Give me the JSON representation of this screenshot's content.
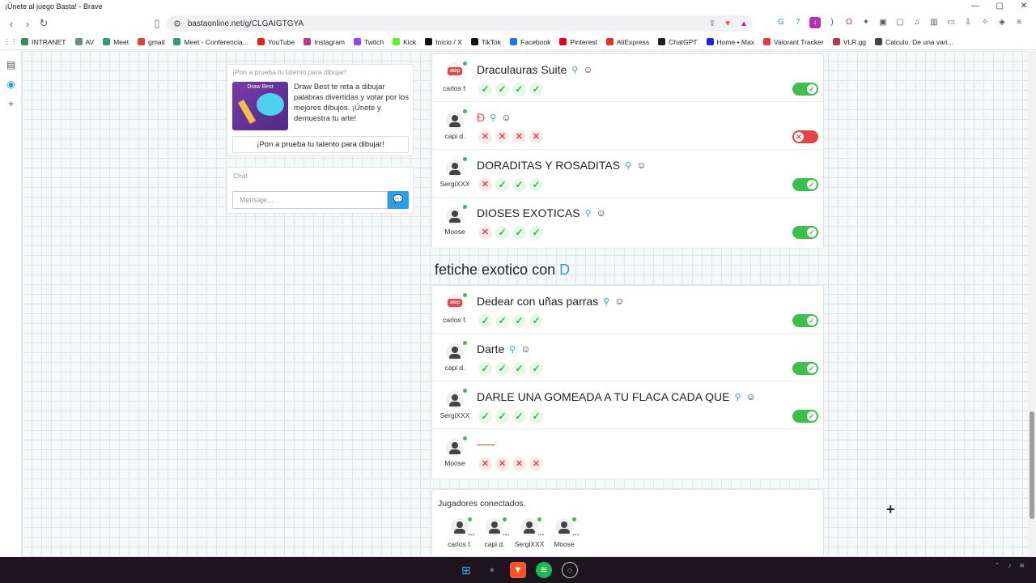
{
  "window": {
    "title": "¡Únete al juego Basta! - Brave",
    "controls": [
      "—",
      "▢",
      "✕"
    ]
  },
  "browser": {
    "url": "bastaonline.net/g/CLGAIGTGYA",
    "bookmarks": [
      {
        "label": "INTRANET",
        "color": "#3a8a5a"
      },
      {
        "label": "AV",
        "color": "#6a8a8a"
      },
      {
        "label": "Meet",
        "color": "#2f9e6a"
      },
      {
        "label": "gmail",
        "color": "#d44638"
      },
      {
        "label": "Meet - Conferencia...",
        "color": "#2f9e6a"
      },
      {
        "label": "YouTube",
        "color": "#e62117"
      },
      {
        "label": "Instagram",
        "color": "#c13584"
      },
      {
        "label": "Twitch",
        "color": "#9146ff"
      },
      {
        "label": "Kick",
        "color": "#53fc18"
      },
      {
        "label": "Inicio / X",
        "color": "#111111"
      },
      {
        "label": "TikTok",
        "color": "#111111"
      },
      {
        "label": "Facebook",
        "color": "#1877f2"
      },
      {
        "label": "Pinterest",
        "color": "#e60023"
      },
      {
        "label": "AliExpress",
        "color": "#e43225"
      },
      {
        "label": "ChatGPT",
        "color": "#222222"
      },
      {
        "label": "Home • Max",
        "color": "#1a2adb"
      },
      {
        "label": "Valorant Tracker",
        "color": "#e43a3a"
      },
      {
        "label": "VLR.gg",
        "color": "#b23a52"
      },
      {
        "label": "Calculo. De una vari...",
        "color": "#444444"
      }
    ]
  },
  "promo": {
    "header": "¡Pon a prueba tu talento para dibujar!",
    "image_title": "Draw Best",
    "text": "Draw Best te reta a dibujar palabras divertidas y votar por los mejores dibujos. ¡Únete y demuestra tu arte!",
    "button": "¡Pon a prueba tu talento para dibujar!"
  },
  "chat": {
    "header": "Chat",
    "placeholder": "Mensaje..."
  },
  "round1": {
    "rows": [
      {
        "user": "carlos f.",
        "word": "Draculauras Suite",
        "marks": [
          "ok",
          "ok",
          "ok",
          "ok"
        ],
        "accepted": true,
        "stop": true
      },
      {
        "user": "capi d.",
        "word": "Đ",
        "marks": [
          "no",
          "no",
          "no",
          "no"
        ],
        "accepted": false,
        "stop": false
      },
      {
        "user": "SergiXXX",
        "word": "DORADITAS Y ROSADITAS",
        "marks": [
          "no",
          "ok",
          "ok",
          "ok"
        ],
        "accepted": true,
        "stop": false
      },
      {
        "user": "Moose",
        "word": "DIOSES EXOTICAS",
        "marks": [
          "no",
          "ok",
          "ok",
          "ok"
        ],
        "accepted": true,
        "stop": false
      }
    ]
  },
  "section2": {
    "title": "fetiche exotico con",
    "letter": "D"
  },
  "round2": {
    "rows": [
      {
        "user": "carlos f.",
        "word": "Dedear con uñas parras",
        "marks": [
          "ok",
          "ok",
          "ok",
          "ok"
        ],
        "accepted": true,
        "stop": true
      },
      {
        "user": "capi d.",
        "word": "Darte",
        "marks": [
          "ok",
          "ok",
          "ok",
          "ok"
        ],
        "accepted": true,
        "stop": false
      },
      {
        "user": "SergiXXX",
        "word": "DARLE UNA GOMEADA A TU FLACA CADA QUE",
        "marks": [
          "ok",
          "ok",
          "ok",
          "ok"
        ],
        "accepted": true,
        "stop": false
      },
      {
        "user": "Moose",
        "word": "",
        "marks": [
          "no",
          "no",
          "no",
          "no"
        ],
        "accepted": null,
        "stop": false
      }
    ]
  },
  "players": {
    "header": "Jugadores conectados.",
    "list": [
      "carlos f.",
      "capi d.",
      "SergiXXX",
      "Moose"
    ]
  },
  "icons": {
    "ok": "✓",
    "no": "✕",
    "search": "🔍",
    "smiley": "☺",
    "send": "💬",
    "stop": "stop"
  }
}
